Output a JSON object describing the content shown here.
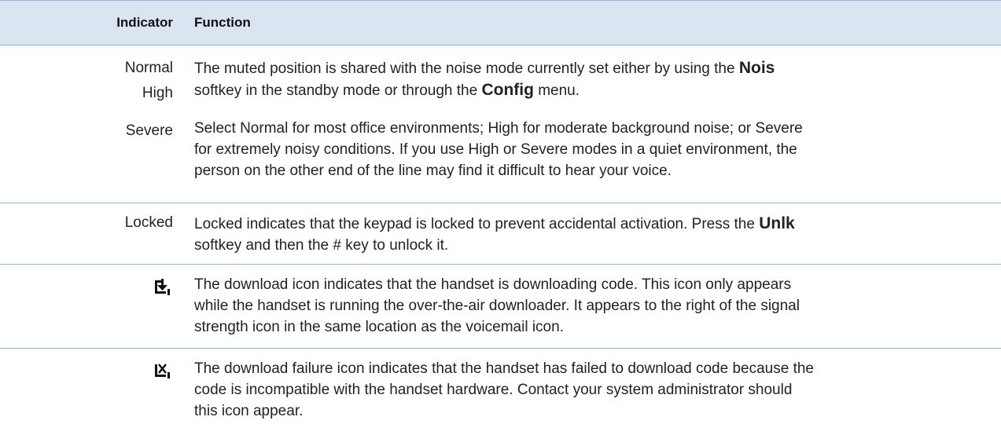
{
  "header": {
    "indicator": "Indicator",
    "function": "Function"
  },
  "rows": [
    {
      "indicators": [
        "Normal",
        "High",
        "Severe"
      ],
      "p1_before": "The muted position is shared with the noise mode currently set either by using the ",
      "p1_bold1": "Nois",
      "p1_line2_before": "softkey in the standby mode or through the ",
      "p1_bold2": "Config",
      "p1_after": " menu.",
      "p2_lines": [
        "Select Normal for most office environments; High for moderate background noise; or Severe",
        "for extremely noisy conditions. If you use High or Severe modes in a quiet environment, the",
        "person on the other end of the line may find it difficult to hear your voice."
      ]
    },
    {
      "indicator": "Locked",
      "line1_before": "Locked indicates that the keypad is locked to prevent accidental activation. Press the ",
      "line1_bold": "Unlk",
      "line2": "softkey and then the # key to unlock it."
    },
    {
      "icon": "download-icon",
      "lines": [
        "The download icon indicates that the handset is downloading code. This icon only appears",
        "while the handset is running the over-the-air downloader. It appears to the right of the signal",
        "strength icon in the same location as the voicemail icon."
      ]
    },
    {
      "icon": "download-failure-icon",
      "lines": [
        "The download failure icon indicates that the handset has failed to download code because the",
        "code is incompatible with the handset hardware. Contact your system administrator should",
        "this icon appear."
      ]
    }
  ],
  "colors": {
    "header_bg": "#dbe5f1",
    "rule": "#95b3d7",
    "text": "#222222"
  }
}
